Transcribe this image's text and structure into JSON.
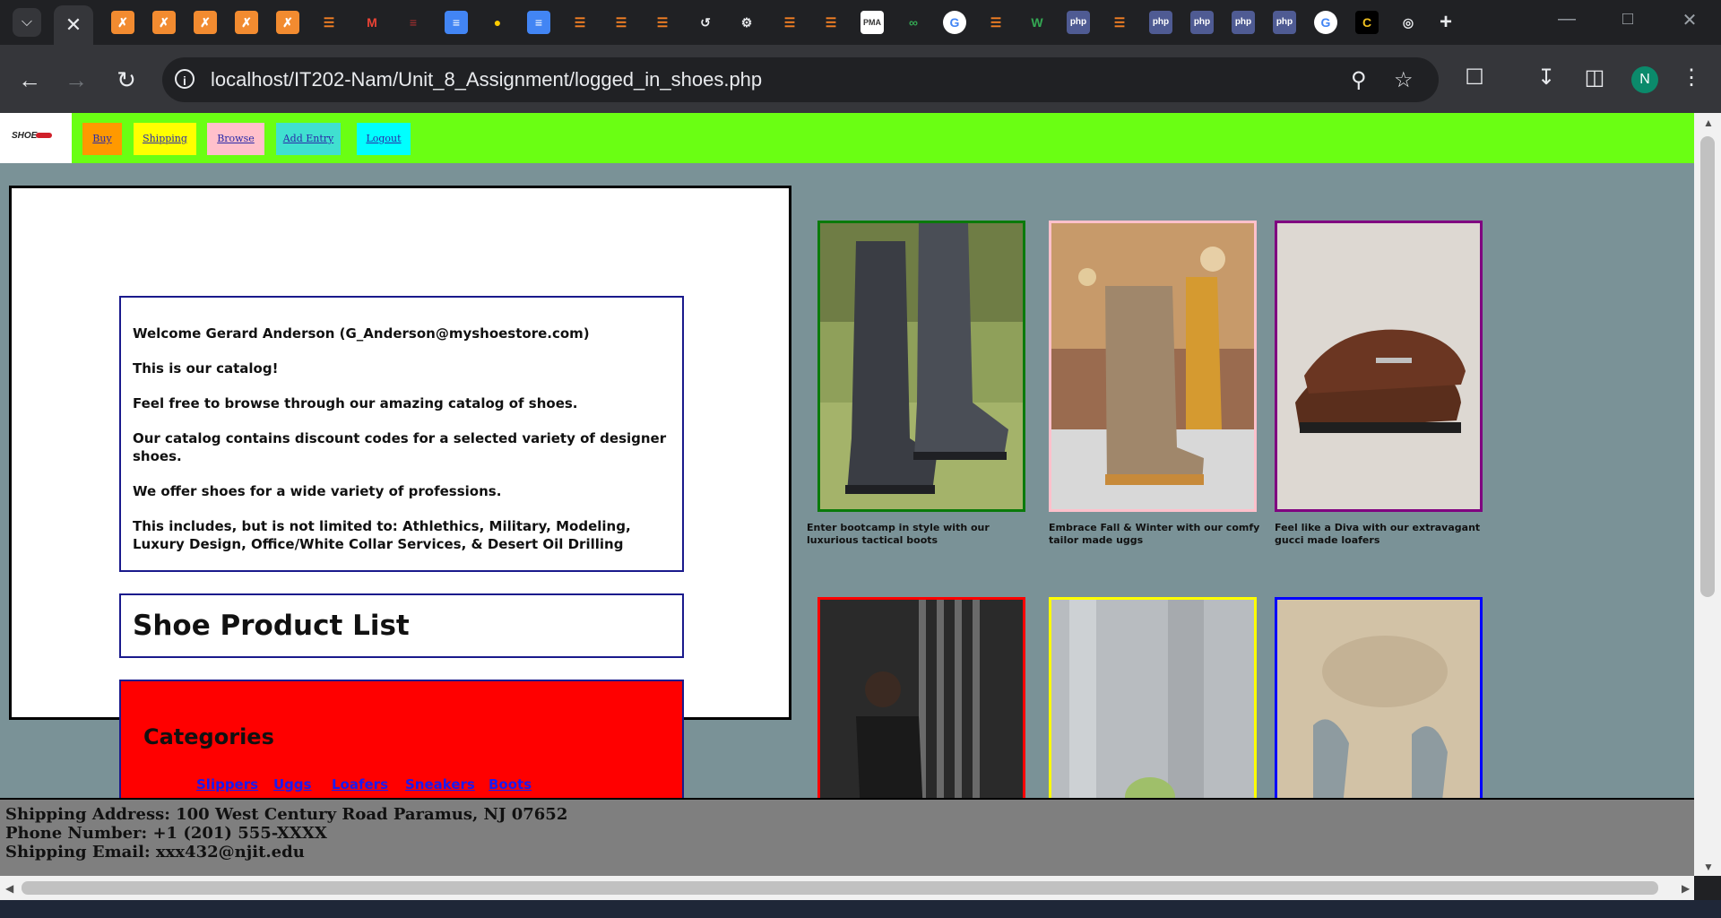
{
  "browser": {
    "active_tab_icon": "close-icon",
    "url": "localhost/IT202-Nam/Unit_8_Assignment/logged_in_shoes.php",
    "profile_initial": "N"
  },
  "site": {
    "logo_text": "SHOE",
    "nav": [
      {
        "label": "Buy",
        "color": "#ff9900"
      },
      {
        "label": "Shipping",
        "color": "#ffff00"
      },
      {
        "label": "Browse",
        "color": "#ffc0cb"
      },
      {
        "label": "Add Entry",
        "color": "#40e0d0"
      },
      {
        "label": "Logout",
        "color": "#00ffff"
      }
    ],
    "welcome": [
      "Welcome Gerard Anderson (G_Anderson@myshoestore.com)",
      "This is our catalog!",
      "Feel free to browse through our amazing catalog of shoes.",
      "Our catalog contains discount codes for a selected variety of designer shoes.",
      "We offer shoes for a wide variety of professions.",
      "This includes, but is not limited to: Athlethics, Military, Modeling, Luxury Design, Office/White Collar Services, & Desert Oil Drilling"
    ],
    "product_list_title": "Shoe Product List",
    "categories_title": "Categories",
    "categories": [
      "Slippers",
      "Uggs",
      "Loafers",
      "Sneakers",
      "Boots"
    ],
    "gallery": [
      {
        "caption": "Enter bootcamp in style with our luxurious tactical boots",
        "border": "#0a7a0a"
      },
      {
        "caption": "Embrace Fall & Winter with our comfy tailor made uggs",
        "border": "#ffc0cb"
      },
      {
        "caption": "Feel like a Diva with our extravagant gucci made loafers",
        "border": "#800080"
      },
      {
        "caption": "",
        "border": "#ff0000"
      },
      {
        "caption": "",
        "border": "#ffff00"
      },
      {
        "caption": "",
        "border": "#0000ff"
      }
    ],
    "footer": {
      "address": "Shipping Address: 100 West Century Road Paramus, NJ 07652",
      "phone": "Phone Number: +1 (201) 555-XXXX",
      "email": "Shipping Email: xxx432@njit.edu"
    }
  }
}
